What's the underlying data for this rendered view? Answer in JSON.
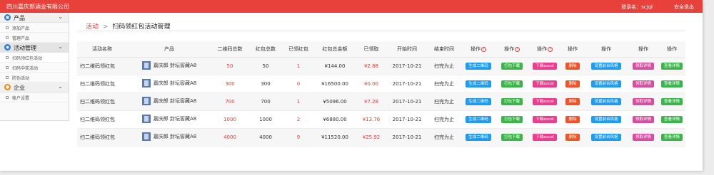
{
  "topbar": {
    "company": "四川嘉庆郎酒业有限公司",
    "login": "登录名：scjql",
    "logout": "安全退出"
  },
  "sidebar": {
    "sections": [
      {
        "label": "产品",
        "icon": "product-icon",
        "items": [
          "添加产品",
          "管理产品"
        ]
      },
      {
        "label": "活动管理",
        "icon": "activity-icon",
        "items": [
          "扫码领红包活动",
          "扫码中奖活动",
          "防伪活动"
        ]
      },
      {
        "label": "企业",
        "icon": "enterprise-icon",
        "items": [
          "帐户设置"
        ]
      }
    ]
  },
  "breadcrumb": {
    "parent": "活动",
    "separator": ">",
    "current": "扫码领红包活动管理"
  },
  "table": {
    "headers": [
      "活动名称",
      "产品",
      "二维码总数",
      "红包总数",
      "已领红包",
      "红包总金额",
      "已领取",
      "开始时间",
      "结束时间",
      "操作",
      "操作",
      "操作",
      "操作",
      "操作",
      "操作",
      "操作"
    ],
    "rows": [
      {
        "name": "扫二维码领红包",
        "product": "嘉庆郎 封坛窖藏A8",
        "qr_total": "50",
        "hb_total": "50",
        "hb_claimed": "1",
        "amount": "¥144.00",
        "claimed_amount": "¥2.88",
        "start": "2017-10-21",
        "end": "扫完为止"
      },
      {
        "name": "扫二维码领红包",
        "product": "嘉庆郎 封坛窖藏A8",
        "qr_total": "300",
        "hb_total": "300",
        "hb_claimed": "0",
        "amount": "¥16500.00",
        "claimed_amount": "¥0.00",
        "start": "2017-10-21",
        "end": "扫完为止"
      },
      {
        "name": "扫二维码领红包",
        "product": "嘉庆郎 封坛窖藏A8",
        "qr_total": "700",
        "hb_total": "700",
        "hb_claimed": "1",
        "amount": "¥5096.00",
        "claimed_amount": "¥7.28",
        "start": "2017-10-21",
        "end": "扫完为止"
      },
      {
        "name": "扫二维码领红包",
        "product": "嘉庆郎 封坛窖藏A8",
        "qr_total": "1000",
        "hb_total": "1000",
        "hb_claimed": "2",
        "amount": "¥6880.00",
        "claimed_amount": "¥13.76",
        "start": "2017-10-21",
        "end": "扫完为止"
      },
      {
        "name": "扫二维码领红包",
        "product": "嘉庆郎 封坛窖藏A8",
        "qr_total": "4000",
        "hb_total": "4000",
        "hb_claimed": "9",
        "amount": "¥11520.00",
        "claimed_amount": "¥25.92",
        "start": "2017-10-21",
        "end": "扫完为止"
      }
    ],
    "actions": [
      "生成二维码",
      "打包下载",
      "下载excel",
      "删除",
      "设置前台风格",
      "领取详情",
      "查看详情"
    ]
  },
  "colors": {
    "accent": "#e8403a",
    "blue": "#1e9cf0",
    "green": "#3bb54a",
    "pink": "#ec3e8c",
    "orange": "#f0532a"
  }
}
